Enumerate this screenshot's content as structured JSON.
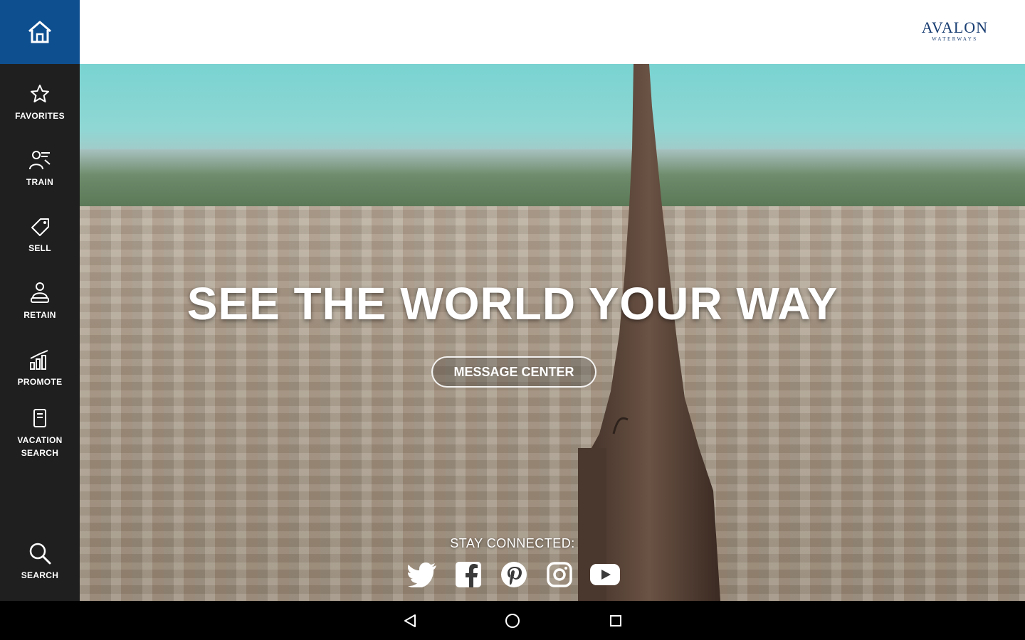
{
  "header": {
    "logo_main": "AVALON",
    "logo_sub": "WATERWAYS"
  },
  "sidebar": {
    "home_icon": "home-icon",
    "items": [
      {
        "label": "FAVORITES",
        "icon": "star-icon"
      },
      {
        "label": "TRAIN",
        "icon": "train-icon"
      },
      {
        "label": "SELL",
        "icon": "sell-tag-icon"
      },
      {
        "label": "RETAIN",
        "icon": "people-icon"
      },
      {
        "label": "PROMOTE",
        "icon": "bar-chart-icon"
      },
      {
        "label": "VACATION\nSEARCH",
        "icon": "document-icon"
      },
      {
        "label": "SEARCH",
        "icon": "search-icon"
      }
    ]
  },
  "hero": {
    "title": "SEE THE WORLD YOUR WAY",
    "button_label": "MESSAGE CENTER",
    "stay_connected": "STAY CONNECTED:",
    "social": [
      "twitter-icon",
      "facebook-icon",
      "pinterest-icon",
      "instagram-icon",
      "youtube-icon"
    ]
  },
  "colors": {
    "home_tile": "#0e4f8f",
    "sidebar_bg": "#1f1f1f",
    "logo": "#1a3f73"
  },
  "system_nav": [
    "back-icon",
    "home-circle-icon",
    "recents-icon"
  ]
}
